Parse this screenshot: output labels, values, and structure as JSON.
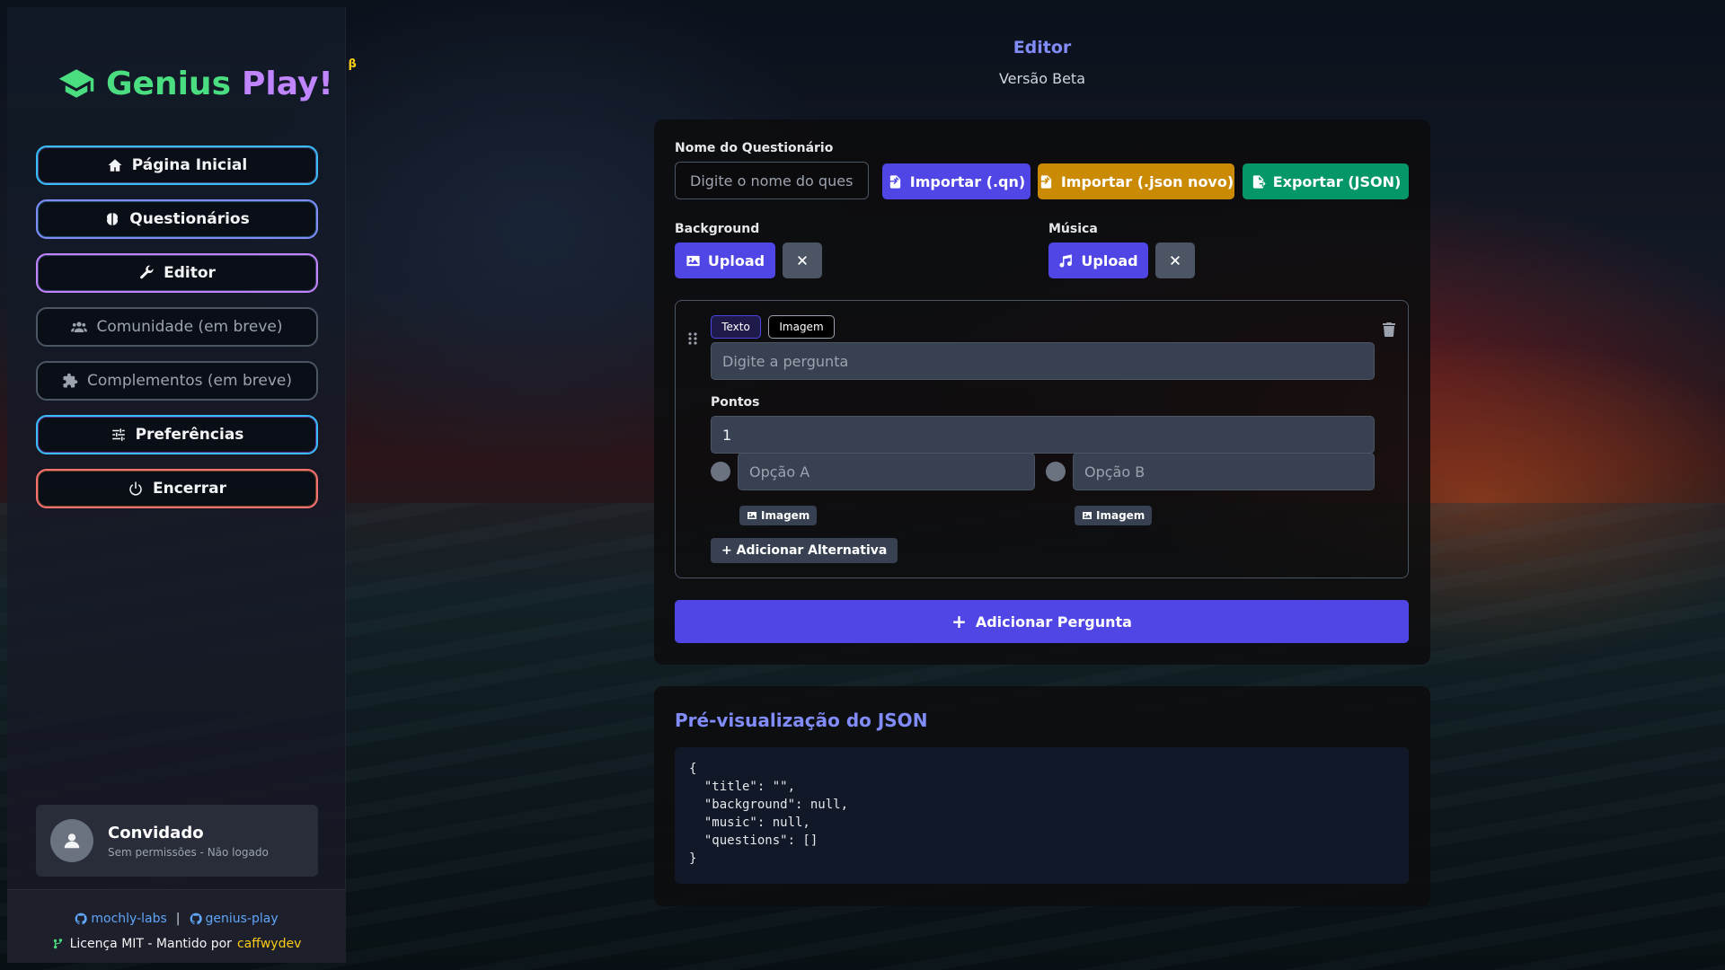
{
  "sidebar": {
    "logo": {
      "word1": "Genius",
      "word2": "Play!",
      "badge": "β"
    },
    "nav": [
      {
        "label": "Página Inicial",
        "icon": "home-icon"
      },
      {
        "label": "Questionários",
        "icon": "brain-icon"
      },
      {
        "label": "Editor",
        "icon": "wrench-icon"
      },
      {
        "label": "Comunidade (em breve)",
        "icon": "users-icon"
      },
      {
        "label": "Complementos (em breve)",
        "icon": "puzzle-icon"
      },
      {
        "label": "Preferências",
        "icon": "sliders-icon"
      },
      {
        "label": "Encerrar",
        "icon": "power-icon"
      }
    ],
    "user": {
      "name": "Convidado",
      "status": "Sem permissões - Não logado"
    },
    "footer": {
      "link1": "mochly-labs",
      "separator": "|",
      "link2": "genius-play",
      "license": "Licença MIT - Mantido por",
      "author": "caffwydev"
    }
  },
  "header": {
    "title": "Editor",
    "subtitle": "Versão Beta"
  },
  "editor": {
    "name_label": "Nome do Questionário",
    "name_placeholder": "Digite o nome do questionário",
    "import_qn": "Importar (.qn)",
    "import_json": "Importar (.json novo)",
    "export_json": "Exportar (JSON)",
    "background_label": "Background",
    "music_label": "Música",
    "upload_label": "Upload",
    "question": {
      "tab_text": "Texto",
      "tab_image": "Imagem",
      "question_placeholder": "Digite a pergunta",
      "points_label": "Pontos",
      "points_value": "1",
      "option_a_placeholder": "Opção A",
      "option_b_placeholder": "Opção B",
      "image_button": "Imagem",
      "add_alternative": "+ Adicionar Alternativa"
    },
    "add_question": "Adicionar Pergunta"
  },
  "preview": {
    "title": "Pré-visualização do JSON",
    "json_text": "{\n  \"title\": \"\",\n  \"background\": null,\n  \"music\": null,\n  \"questions\": []\n}"
  },
  "colors": {
    "accent": "#4f46e5",
    "amber": "#ca8a04",
    "green": "#059669",
    "title": "#818cf8"
  }
}
